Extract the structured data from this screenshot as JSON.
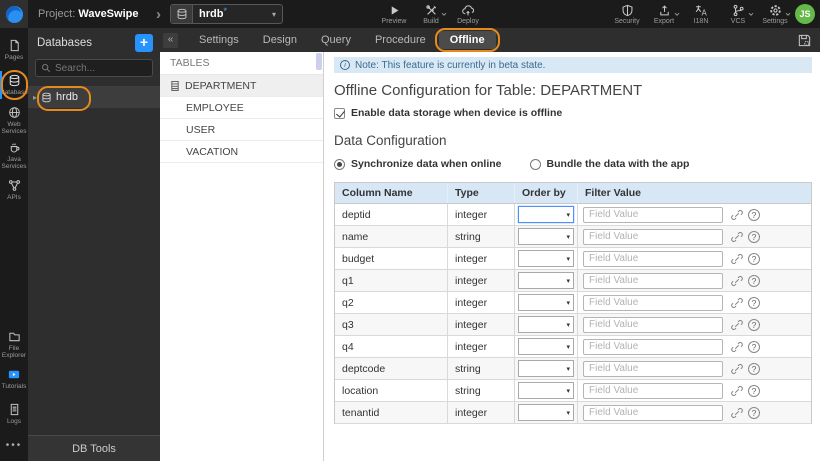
{
  "topbar": {
    "project_label": "Project:",
    "project_name": "WaveSwipe",
    "db_selector": {
      "value": "hrdb",
      "modified_mark": "*"
    },
    "preview_label": "Preview",
    "build_label": "Build",
    "deploy_label": "Deploy",
    "security_label": "Security",
    "export_label": "Export",
    "i18n_label": "I18N",
    "vcs_label": "VCS",
    "settings_label": "Settings",
    "avatar_initials": "JS"
  },
  "sidebar": {
    "items": [
      {
        "label": "Pages"
      },
      {
        "label": "Databases",
        "active": true,
        "annotated": true
      },
      {
        "label": "Web Services"
      },
      {
        "label": "Java Services"
      },
      {
        "label": "APIs"
      },
      {
        "label": "File Explorer"
      },
      {
        "label": "Tutorials"
      },
      {
        "label": "Logs"
      }
    ]
  },
  "db_panel": {
    "title": "Databases",
    "add_label": "+",
    "search_placeholder": "Search...",
    "connection": {
      "label": "hrdb",
      "annotated": true
    },
    "footer_label": "DB Tools"
  },
  "tabbar": {
    "collapse_label": "«",
    "tabs": [
      {
        "label": "Settings"
      },
      {
        "label": "Design"
      },
      {
        "label": "Query"
      },
      {
        "label": "Procedure"
      },
      {
        "label": "Offline",
        "active": true,
        "annotated": true
      }
    ]
  },
  "tables_panel": {
    "title": "TABLES",
    "items": [
      {
        "label": "DEPARTMENT",
        "active": true
      },
      {
        "label": "EMPLOYEE"
      },
      {
        "label": "USER"
      },
      {
        "label": "VACATION"
      }
    ]
  },
  "main": {
    "note_text": "Note: This feature is currently in beta state.",
    "title": "Offline Configuration for Table: DEPARTMENT",
    "enable_label": "Enable data storage when device is offline",
    "enable_checked": true,
    "section_title": "Data Configuration",
    "sync_options": [
      {
        "label": "Synchronize data when online",
        "selected": true
      },
      {
        "label": "Bundle the data with the app"
      }
    ],
    "table": {
      "headers": [
        "Column Name",
        "Type",
        "Order by",
        "Filter Value"
      ],
      "filter_placeholder": "Field Value",
      "rows": [
        {
          "name": "deptid",
          "type": "integer",
          "focused": true
        },
        {
          "name": "name",
          "type": "string"
        },
        {
          "name": "budget",
          "type": "integer"
        },
        {
          "name": "q1",
          "type": "integer"
        },
        {
          "name": "q2",
          "type": "integer"
        },
        {
          "name": "q3",
          "type": "integer"
        },
        {
          "name": "q4",
          "type": "integer"
        },
        {
          "name": "deptcode",
          "type": "string"
        },
        {
          "name": "location",
          "type": "string"
        },
        {
          "name": "tenantid",
          "type": "integer"
        }
      ]
    }
  },
  "colors": {
    "accent_blue": "#2693ff",
    "annotation_orange": "#e78a1e",
    "note_bg": "#d9e8f5",
    "note_fg": "#3a6b8e",
    "table_header_bg": "#d7e7f6",
    "avatar_green": "#64b948",
    "focus_blue": "#4d90fe"
  }
}
